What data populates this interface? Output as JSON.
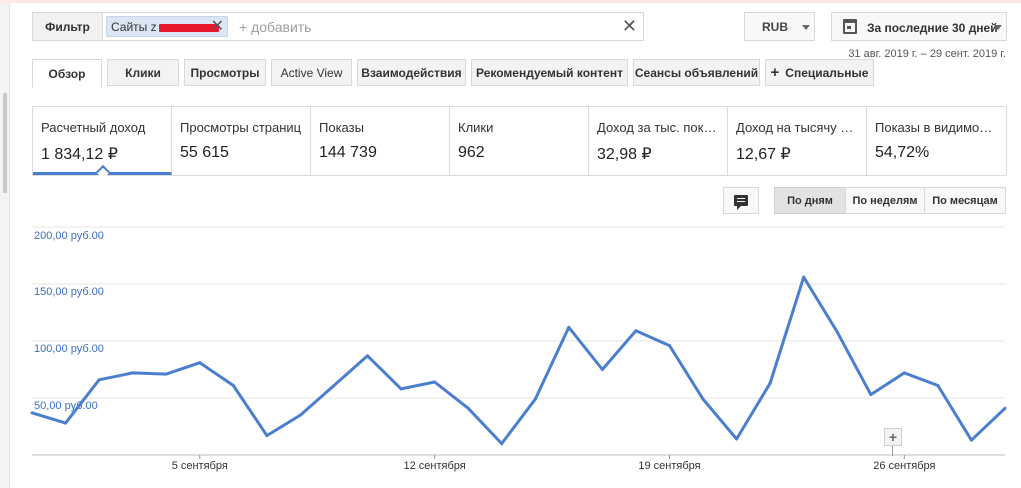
{
  "filter": {
    "filter_label": "Фильтр",
    "chip_label": "Сайты z",
    "chip_remove_icon": "close-icon",
    "add_placeholder": "+ добавить",
    "clear_icon": "close-icon"
  },
  "currency": {
    "value": "RUB"
  },
  "date_range": {
    "label": "За последние 30 дней",
    "subtitle": "31 авг. 2019 г. – 29 сент. 2019 г."
  },
  "tabs": [
    {
      "label": "Обзор",
      "active": true
    },
    {
      "label": "Клики"
    },
    {
      "label": "Просмотры"
    },
    {
      "label": "Active View"
    },
    {
      "label": "Взаимодействия"
    },
    {
      "label": "Рекомендуемый контент"
    },
    {
      "label": "Сеансы объявлений"
    },
    {
      "label": "Специальные"
    }
  ],
  "metrics": [
    {
      "label": "Расчетный доход",
      "value": "1 834,12 ₽",
      "active": true
    },
    {
      "label": "Просмотры страниц",
      "value": "55 615"
    },
    {
      "label": "Показы",
      "value": "144 739"
    },
    {
      "label": "Клики",
      "value": "962"
    },
    {
      "label": "Доход за тыс. показов",
      "value": "32,98 ₽"
    },
    {
      "label": "Доход на тысячу запросов",
      "value": "12,67 ₽"
    },
    {
      "label": "Показы в видимой области",
      "value": "54,72%"
    }
  ],
  "chart_controls": {
    "annotation_icon": "comment-icon",
    "periods": [
      "По дням",
      "По неделям",
      "По месяцам"
    ],
    "active_period": "По дням"
  },
  "chart_data": {
    "type": "line",
    "title": "",
    "xlabel": "",
    "ylabel": "",
    "ylim": [
      0,
      200
    ],
    "y_ticks": [
      {
        "value": 50,
        "label": "50,00 руб.00"
      },
      {
        "value": 100,
        "label": "100,00 руб.00"
      },
      {
        "value": 150,
        "label": "150,00 руб.00"
      },
      {
        "value": 200,
        "label": "200,00 руб.00"
      }
    ],
    "x_ticks": [
      {
        "date": "2019-09-05",
        "label": "5 сентября"
      },
      {
        "date": "2019-09-12",
        "label": "12 сентября"
      },
      {
        "date": "2019-09-19",
        "label": "19 сентября"
      },
      {
        "date": "2019-09-26",
        "label": "26 сентября"
      }
    ],
    "grid": true,
    "series": [
      {
        "color": "#4a7fd0",
        "x": [
          "2019-08-31",
          "2019-09-01",
          "2019-09-02",
          "2019-09-03",
          "2019-09-04",
          "2019-09-05",
          "2019-09-06",
          "2019-09-07",
          "2019-09-08",
          "2019-09-09",
          "2019-09-10",
          "2019-09-11",
          "2019-09-12",
          "2019-09-13",
          "2019-09-14",
          "2019-09-15",
          "2019-09-16",
          "2019-09-17",
          "2019-09-18",
          "2019-09-19",
          "2019-09-20",
          "2019-09-21",
          "2019-09-22",
          "2019-09-23",
          "2019-09-24",
          "2019-09-25",
          "2019-09-26",
          "2019-09-27",
          "2019-09-28",
          "2019-09-29"
        ],
        "values": [
          37,
          28,
          66,
          72,
          71,
          81,
          61,
          17,
          35,
          61,
          87,
          58,
          64,
          41,
          10,
          49,
          112,
          75,
          109,
          96,
          49,
          14,
          63,
          156,
          108,
          53,
          72,
          61,
          13,
          41
        ]
      }
    ]
  }
}
